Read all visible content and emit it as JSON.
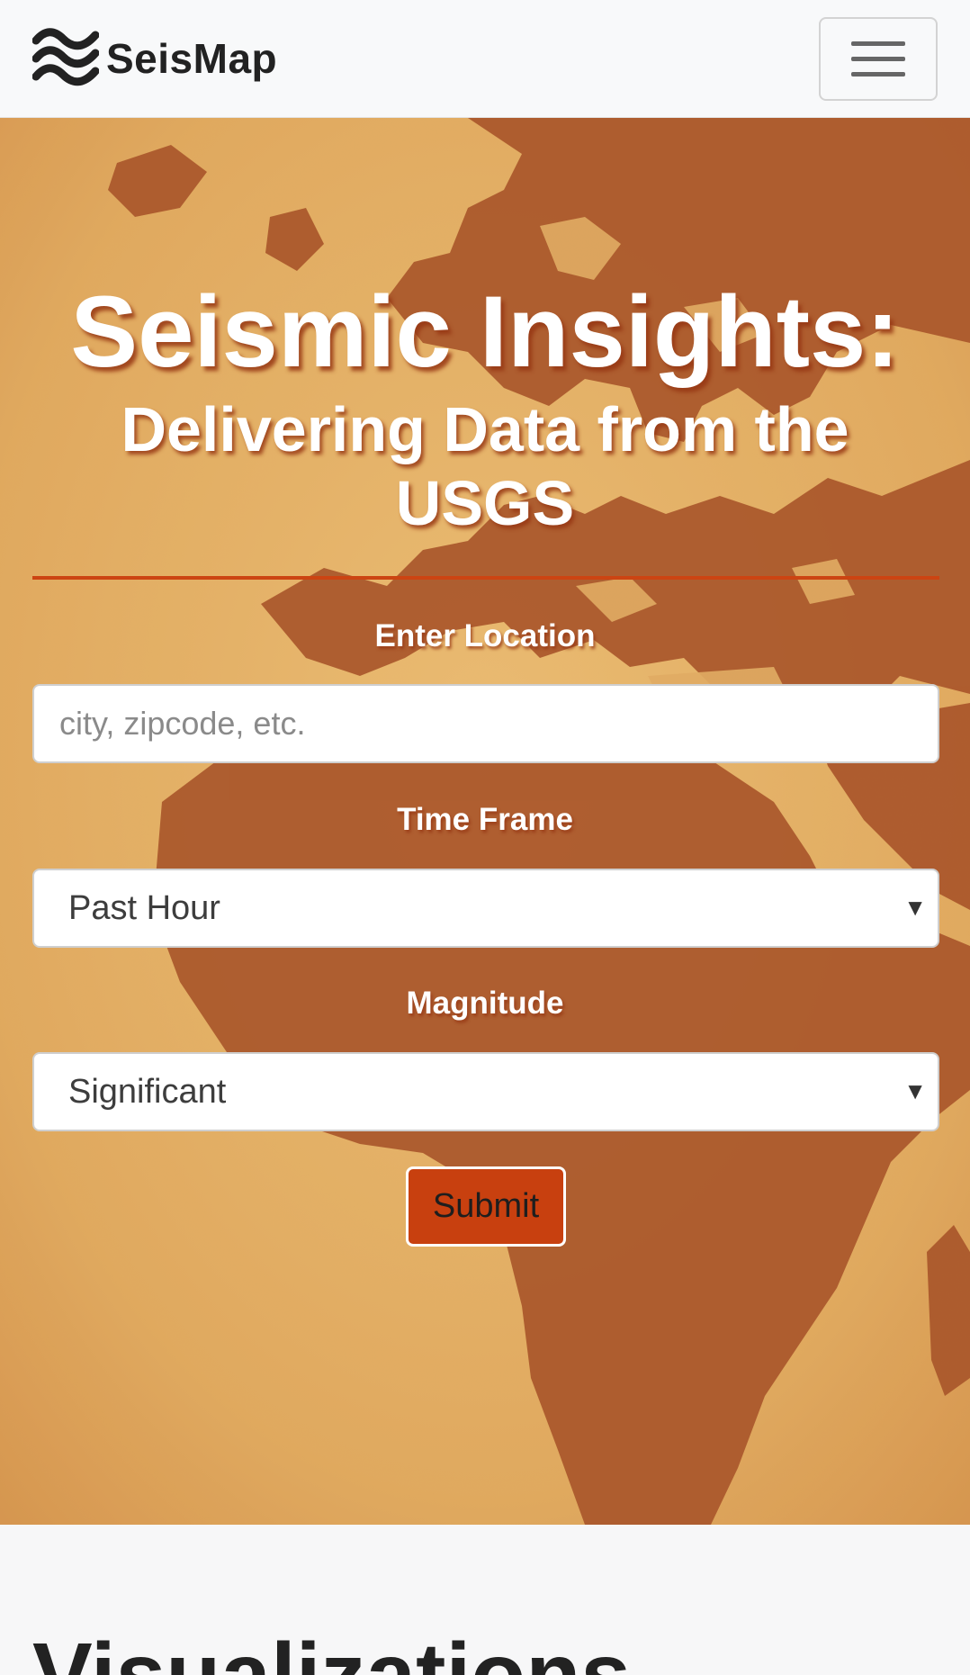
{
  "navbar": {
    "brand_text": "SeisMap",
    "logo_icon": "waves-logo-icon",
    "menu_icon": "hamburger-menu-icon"
  },
  "hero": {
    "title": "Seismic Insights:",
    "subtitle": "Delivering Data from the USGS",
    "location": {
      "label": "Enter Location",
      "value": "",
      "placeholder": "city, zipcode, etc."
    },
    "time_frame": {
      "label": "Time Frame",
      "selected": "Past Hour"
    },
    "magnitude": {
      "label": "Magnitude",
      "selected": "Significant"
    },
    "submit_label": "Submit"
  },
  "visualizations": {
    "heading": "Visualizations"
  },
  "colors": {
    "accent": "#cc4412",
    "navbar_bg": "#f8f9fa",
    "map_light": "#e7b569",
    "map_dark": "#a8552a"
  }
}
